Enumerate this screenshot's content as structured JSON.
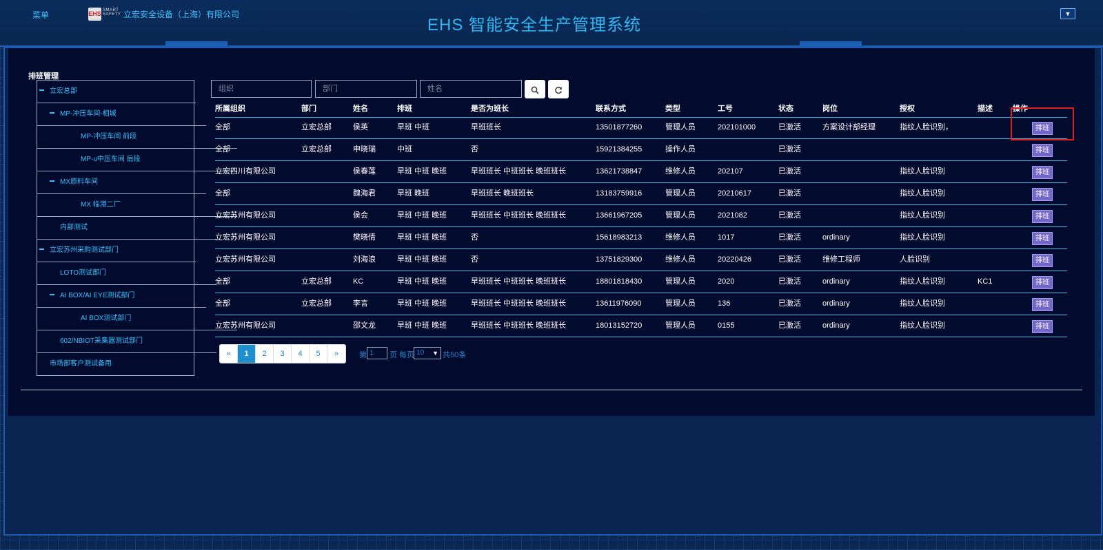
{
  "header": {
    "menu": "菜单",
    "company": "立宏安全设备（上海）有限公司",
    "title": "EHS 智能安全生产管理系统",
    "logo_mark": "EHS",
    "logo_text": "SMART SAFETY"
  },
  "section_title": "排班管理",
  "tree": [
    {
      "label": "立宏总部",
      "level": 0,
      "expanded": true
    },
    {
      "label": "MP-冲压车间-相城",
      "level": 1,
      "expanded": true
    },
    {
      "label": "MP-冲压车间 前段",
      "level": 2,
      "expanded": false
    },
    {
      "label": "MP-u中压车间 后段",
      "level": 2,
      "expanded": false
    },
    {
      "label": "MX原料车间",
      "level": 1,
      "expanded": true
    },
    {
      "label": "MX 临港二厂",
      "level": 2,
      "expanded": false
    },
    {
      "label": "内部测试",
      "level": 1,
      "expanded": false
    },
    {
      "label": "立宏苏州采购测试部门",
      "level": 0,
      "expanded": true
    },
    {
      "label": "LOTO测试部门",
      "level": 1,
      "expanded": false
    },
    {
      "label": "AI BOX/AI EYE测试部门",
      "level": 1,
      "expanded": true
    },
    {
      "label": "AI BOX测试部门",
      "level": 2,
      "expanded": false
    },
    {
      "label": "602/NBIOT采集器测试部门",
      "level": 1,
      "expanded": false
    },
    {
      "label": "市场部客户测试备用",
      "level": 0,
      "expanded": false
    }
  ],
  "search": {
    "org_placeholder": "组织",
    "dept_placeholder": "部门",
    "name_placeholder": "姓名"
  },
  "columns": [
    "所属组织",
    "部门",
    "姓名",
    "排班",
    "是否为班长",
    "联系方式",
    "类型",
    "工号",
    "状态",
    "岗位",
    "授权",
    "描述",
    "操作"
  ],
  "rows": [
    [
      "全部",
      "立宏总部",
      "侯英",
      "早班 中班",
      "早班班长",
      "13501877260",
      "管理人员",
      "202101000",
      "已激活",
      "方案设计部经理",
      "指纹人脸识别，",
      ""
    ],
    [
      "全部",
      "立宏总部",
      "申晓瑞",
      "中班",
      "否",
      "15921384255",
      "操作人员",
      "",
      "已激活",
      "",
      "",
      ""
    ],
    [
      "立宏四川有限公司",
      "",
      "侯春莲",
      "早班 中班 晚班",
      "早班班长 中班班长 晚班班长",
      "13621738847",
      "维修人员",
      "202107",
      "已激活",
      "",
      "指纹人脸识别",
      ""
    ],
    [
      "全部",
      "",
      "魏海君",
      "早班 晚班",
      "早班班长 晚班班长",
      "13183759916",
      "管理人员",
      "20210617",
      "已激活",
      "",
      "指纹人脸识别",
      ""
    ],
    [
      "立宏苏州有限公司",
      "",
      "侯会",
      "早班 中班 晚班",
      "早班班长 中班班长 晚班班长",
      "13661967205",
      "管理人员",
      "2021082",
      "已激活",
      "",
      "指纹人脸识别",
      ""
    ],
    [
      "立宏苏州有限公司",
      "",
      "樊晓倩",
      "早班 中班 晚班",
      "否",
      "15618983213",
      "维修人员",
      "1017",
      "已激活",
      "ordinary",
      "指纹人脸识别",
      ""
    ],
    [
      "立宏苏州有限公司",
      "",
      "刘海浪",
      "早班 中班 晚班",
      "否",
      "13751829300",
      "维修人员",
      "20220426",
      "已激活",
      "维修工程师",
      "人脸识别",
      ""
    ],
    [
      "全部",
      "立宏总部",
      "KC",
      "早班 中班 晚班",
      "早班班长 中班班长 晚班班长",
      "18801818430",
      "管理人员",
      "2020",
      "已激活",
      "ordinary",
      "指纹人脸识别",
      "KC1"
    ],
    [
      "全部",
      "立宏总部",
      "李言",
      "早班 中班 晚班",
      "早班班长 中班班长 晚班班长",
      "13611976090",
      "管理人员",
      "136",
      "已激活",
      "ordinary",
      "指纹人脸识别",
      ""
    ],
    [
      "立宏苏州有限公司",
      "",
      "邵文龙",
      "早班 中班 晚班",
      "早班班长 中班班长 晚班班长",
      "18013152720",
      "管理人员",
      "0155",
      "已激活",
      "ordinary",
      "指纹人脸识别",
      ""
    ]
  ],
  "action_label": "排班",
  "pagination": {
    "pages": [
      "«",
      "1",
      "2",
      "3",
      "4",
      "5",
      "»"
    ],
    "current": "1",
    "prefix": "第",
    "page_value": "1",
    "mid": "页 每页",
    "page_size": "10",
    "total": "共50条"
  },
  "colors": {
    "accent": "#35c2ff",
    "highlight": "#e81c1c",
    "action_button": "#7367c9"
  }
}
